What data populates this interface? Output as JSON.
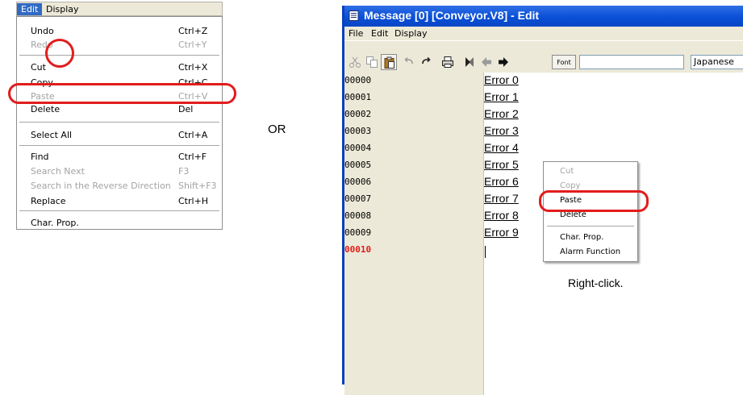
{
  "left_menu": {
    "menubar": [
      "Edit",
      "Display"
    ],
    "items": [
      {
        "label": "Undo",
        "shortcut": "Ctrl+Z"
      },
      {
        "label": "Redo",
        "shortcut": "Ctrl+Y"
      },
      {
        "label": "Cut",
        "shortcut": "Ctrl+X"
      },
      {
        "label": "Copy",
        "shortcut": "Ctrl+C"
      },
      {
        "label": "Paste",
        "shortcut": "Ctrl+V"
      },
      {
        "label": "Delete",
        "shortcut": "Del"
      },
      {
        "label": "Select All",
        "shortcut": "Ctrl+A"
      },
      {
        "label": "Find",
        "shortcut": "Ctrl+F"
      },
      {
        "label": "Search Next",
        "shortcut": "F3"
      },
      {
        "label": "Search in the Reverse Direction",
        "shortcut": "Shift+F3"
      },
      {
        "label": "Replace",
        "shortcut": "Ctrl+H"
      },
      {
        "label": "Char. Prop.",
        "shortcut": ""
      }
    ]
  },
  "or_text": "OR",
  "window": {
    "title": "Message [0] [Conveyor.V8] - Edit",
    "menu": [
      "File",
      "Edit",
      "Display"
    ],
    "font_button": "Font",
    "font_input_value": "",
    "language": "Japanese",
    "line_numbers": [
      "00000",
      "00001",
      "00002",
      "00003",
      "00004",
      "00005",
      "00006",
      "00007",
      "00008",
      "00009",
      "00010"
    ],
    "messages": [
      "Error 0",
      "Error 1",
      "Error 2",
      "Error 3",
      "Error 4",
      "Error 5",
      "Error 6",
      "Error 7",
      "Error 8",
      "Error 9"
    ]
  },
  "context_menu": {
    "items": [
      "Cut",
      "Copy",
      "Paste",
      "Delete",
      "Char. Prop.",
      "Alarm Function"
    ]
  },
  "caption": "Right-click.",
  "colors": {
    "highlight": "#e21c1c",
    "title_bar": "#0a4fd6",
    "menu_select": "#316ac5"
  }
}
